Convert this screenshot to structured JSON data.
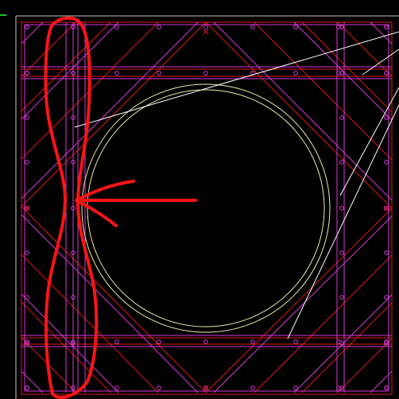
{
  "viewer": {
    "background": "#000000",
    "colors": {
      "frame_white": "#c8c8c8",
      "grid_red": "#e01818",
      "rails_magenta": "#d838d8",
      "circle_yellow": "#e6f0a0",
      "leader_white": "#ffffff",
      "annotation_red": "#ff1414",
      "corner_green": "#18c818"
    },
    "icons": [
      "x-marker-icon",
      "circle-marker-icon"
    ]
  }
}
